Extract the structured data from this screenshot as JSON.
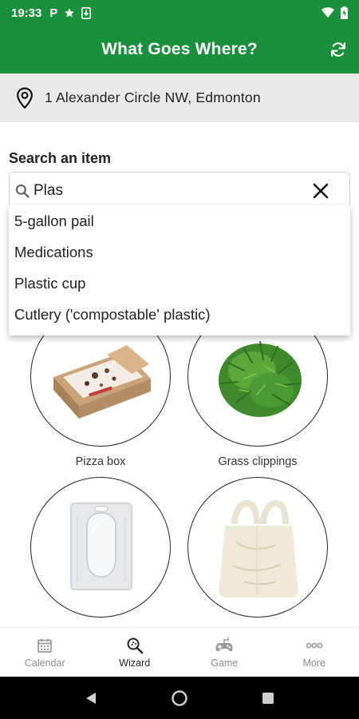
{
  "status_bar": {
    "time": "19:33"
  },
  "app_bar": {
    "title": "What Goes Where?"
  },
  "location": {
    "address": "1 Alexander Circle NW, Edmonton"
  },
  "search": {
    "label": "Search an item",
    "value": "Plas"
  },
  "suggestions": [
    "5-gallon pail",
    "Medications",
    "Plastic cup",
    "Cutlery ('compostable' plastic)"
  ],
  "items": [
    {
      "label": "Pizza box"
    },
    {
      "label": "Grass clippings"
    },
    {
      "label": ""
    },
    {
      "label": ""
    }
  ],
  "bottom_nav": [
    {
      "label": "Calendar",
      "icon": "calendar-icon",
      "active": false
    },
    {
      "label": "Wizard",
      "icon": "wizard-search-icon",
      "active": true
    },
    {
      "label": "Game",
      "icon": "game-controller-icon",
      "active": false
    },
    {
      "label": "More",
      "icon": "more-dots-icon",
      "active": false
    }
  ],
  "colors": {
    "primary": "#1a8f3c",
    "address_bg": "#e9e9e9"
  }
}
